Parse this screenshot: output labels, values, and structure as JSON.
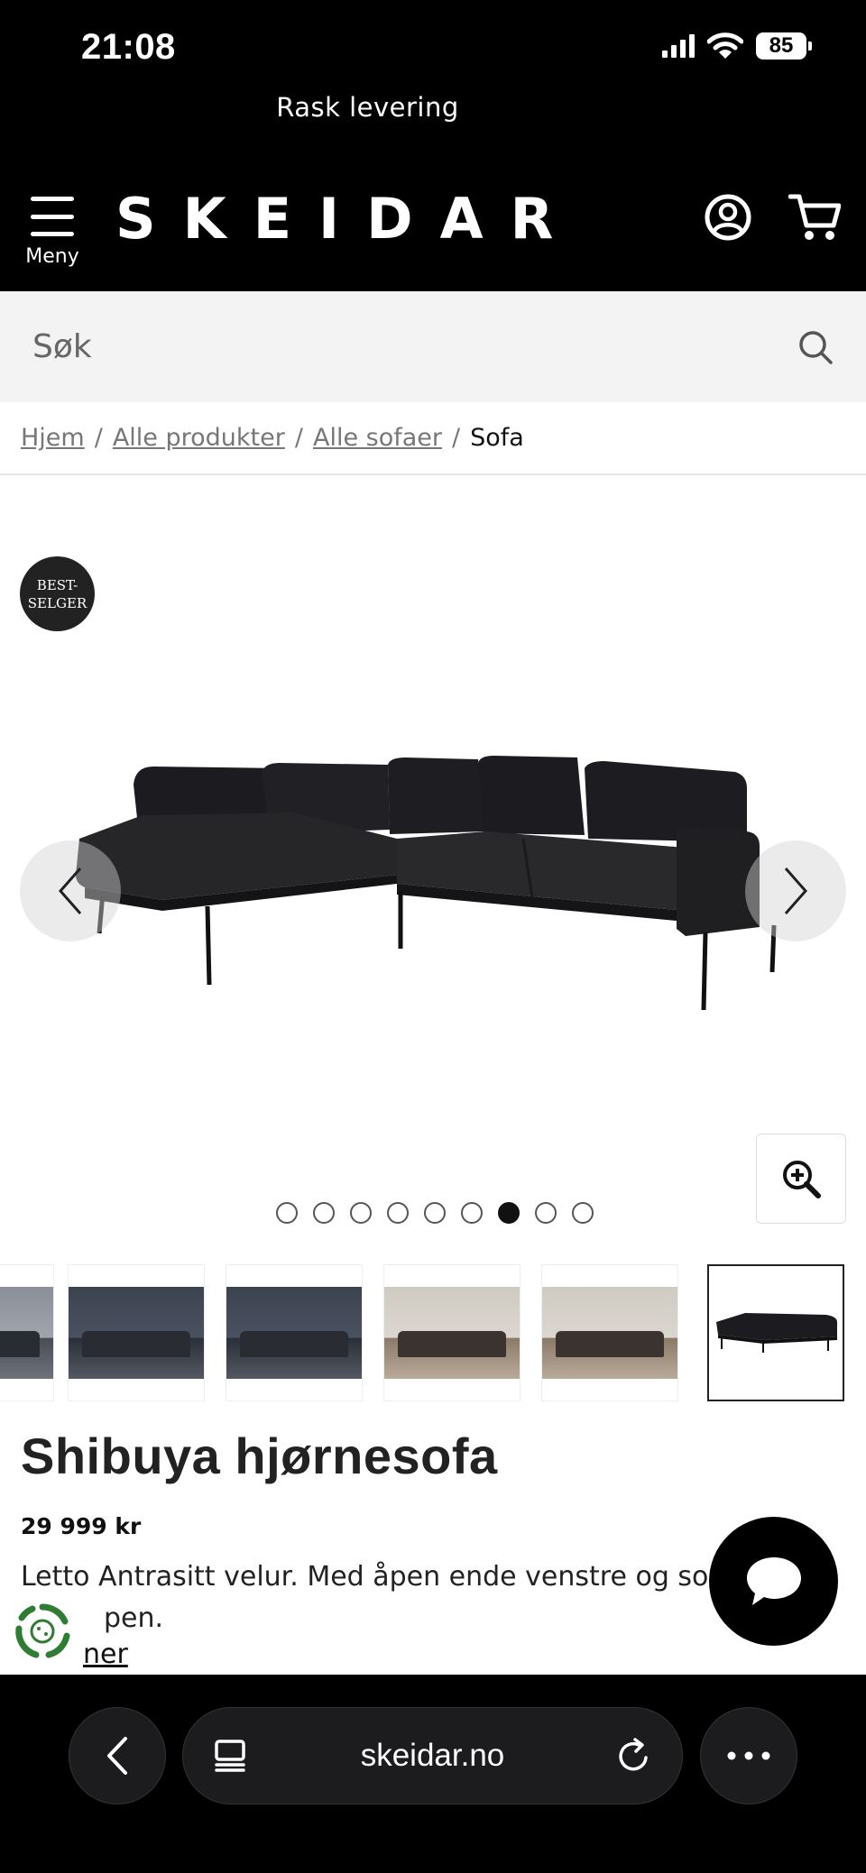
{
  "status_bar": {
    "time": "21:08",
    "battery": "85"
  },
  "promo": {
    "text": "Rask levering"
  },
  "header": {
    "menu_label": "Meny",
    "logo": "SKEIDAR"
  },
  "search": {
    "placeholder": "Søk"
  },
  "breadcrumb": {
    "items": [
      "Hjem",
      "Alle produkter",
      "Alle sofaer"
    ],
    "separator": "/",
    "current": "Sofa"
  },
  "gallery": {
    "badge_line1": "BEST-",
    "badge_line2": "SELGER",
    "total_images": 9,
    "active_index": 6
  },
  "product": {
    "title": "Shibuya hjørnesofa",
    "price": "29 999 kr",
    "description_line1": "Letto Antrasitt velur. Med åpen ende venstre og so",
    "description_line2": "pen.",
    "more_link": "ner"
  },
  "browser": {
    "url": "skeidar.no"
  },
  "colors": {
    "header_bg": "#000000",
    "search_bg": "#f3f3f3",
    "sofa": "#1c1c1f"
  }
}
